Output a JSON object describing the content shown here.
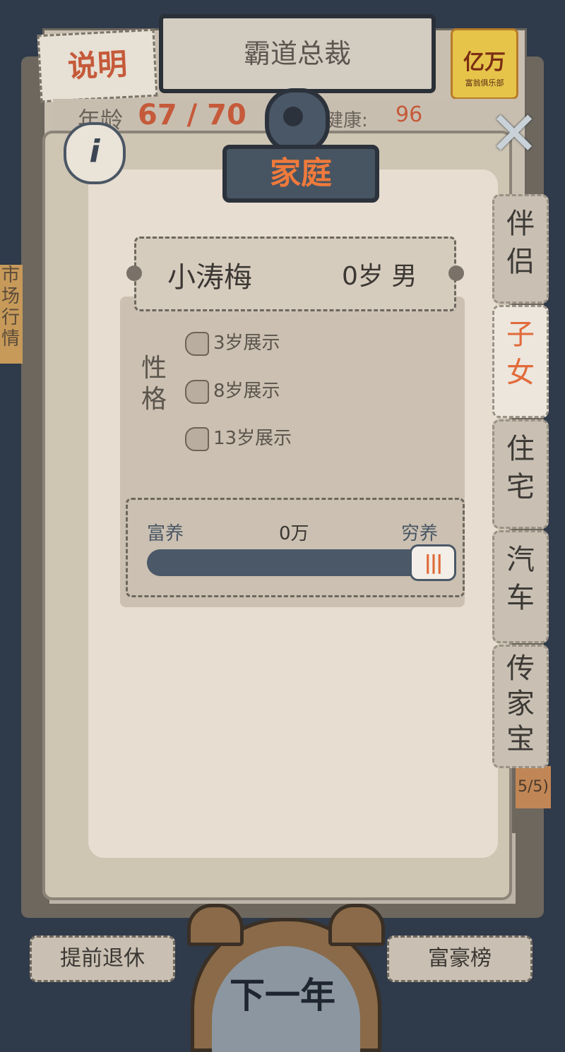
{
  "background": {
    "top_tag": "说明",
    "career_title": "霸道总裁",
    "club_badge": {
      "line1": "亿万",
      "line2": "富翁俱乐部"
    },
    "age_label": "年龄",
    "age_value": "67 / 70",
    "health_label": "健康:",
    "health_value": "96",
    "side_note": "市场行情",
    "right_count": "5/5)"
  },
  "panel": {
    "title": "家庭",
    "info_icon": "i",
    "close_icon": "✕"
  },
  "tabs": [
    {
      "label": "伴侣",
      "active": false
    },
    {
      "label": "子女",
      "active": true
    },
    {
      "label": "住宅",
      "active": false
    },
    {
      "label": "汽车",
      "active": false
    },
    {
      "label": "传家宝",
      "active": false
    }
  ],
  "child": {
    "name": "小涛梅",
    "age_gender": "0岁 男",
    "personality_title": "性格",
    "personality_slots": [
      "3岁展示",
      "8岁展示",
      "13岁展示"
    ]
  },
  "upbringing": {
    "left_label": "富养",
    "amount": "0万",
    "right_label": "穷养",
    "knob_glyph": "|||",
    "position_fraction": 1.0
  },
  "bottom": {
    "retire_label": "提前退休",
    "next_year_label": "下一年",
    "rich_list_label": "富豪榜"
  },
  "colors": {
    "accent": "#e16a3a",
    "dark_slate": "#4b5868",
    "paper": "#e7ddd0"
  }
}
